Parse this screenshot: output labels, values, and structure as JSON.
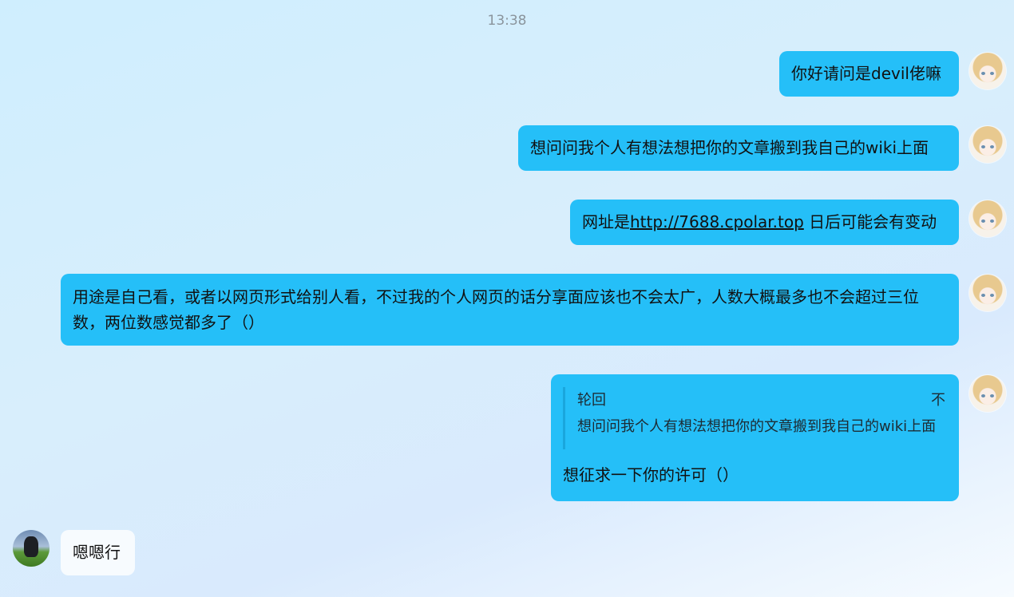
{
  "chat": {
    "timestamp": "13:38",
    "messages": [
      {
        "text": "你好请问是devil佬嘛"
      },
      {
        "text": "想问问我个人有想法想把你的文章搬到我自己的wiki上面"
      },
      {
        "prefix": "网址是",
        "link": "http://7688.cpolar.top",
        "suffix": " 日后可能会有变动"
      },
      {
        "text": "用途是自己看，或者以网页形式给别人看，不过我的个人网页的话分享面应该也不会太广，人数大概最多也不会超过三位数，两位数感觉都多了（）"
      },
      {
        "quote_author": "轮回",
        "quote_close": "不",
        "quote_text": "想问问我个人有想法想把你的文章搬到我自己的wiki上面",
        "text": "想征求一下你的许可（）"
      }
    ],
    "reply": {
      "text": "嗯嗯行"
    }
  },
  "colors": {
    "outgoing_bubble": "#25bff8",
    "incoming_bubble": "#f7fbfe"
  }
}
